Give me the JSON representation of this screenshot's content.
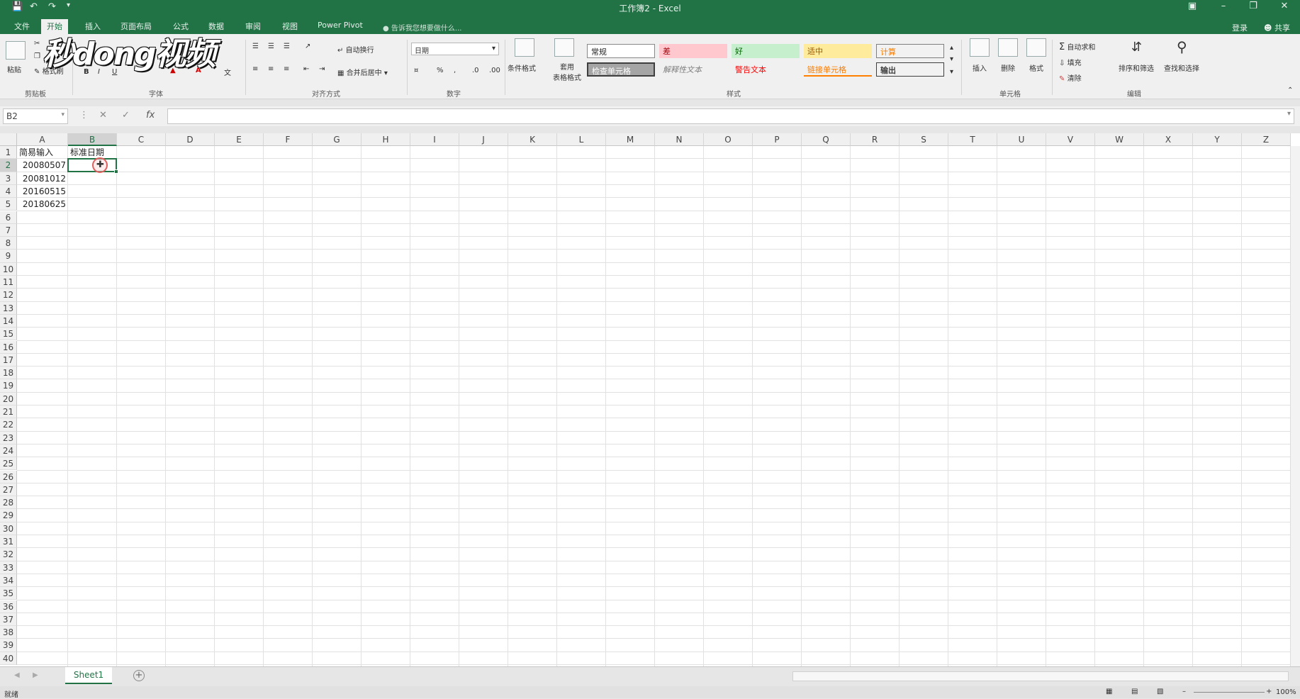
{
  "window": {
    "title": "工作簿2 - Excel",
    "quick_access": [
      "save-icon",
      "undo-icon",
      "redo-icon"
    ],
    "controls": [
      "ribbon-display-icon",
      "minimize-icon",
      "restore-icon",
      "close-icon"
    ]
  },
  "tabs": [
    "文件",
    "开始",
    "插入",
    "页面布局",
    "公式",
    "数据",
    "审阅",
    "视图",
    "Power Pivot"
  ],
  "active_tab": "开始",
  "tell_me": "告诉我您想要做什么...",
  "account": {
    "login": "登录",
    "share": "共享"
  },
  "watermark": "秒dong视频",
  "ribbon": {
    "clipboard": {
      "paste": "粘贴",
      "format_painter": "格式刷",
      "label": "剪贴板"
    },
    "font": {
      "label": "字体",
      "bold": "B",
      "italic": "I",
      "underline": "U"
    },
    "alignment": {
      "wrap": "自动换行",
      "merge": "合并后居中",
      "label": "对齐方式"
    },
    "number": {
      "format": "日期",
      "percent": "%",
      "label": "数字"
    },
    "styles": {
      "conditional": "条件格式",
      "table_format": "套用\n表格格式",
      "cells": [
        "常规",
        "差",
        "好",
        "适中",
        "计算",
        "检查单元格",
        "解释性文本",
        "警告文本",
        "链接单元格",
        "输出"
      ],
      "label": "样式"
    },
    "cells_group": {
      "insert": "插入",
      "delete": "删除",
      "format": "格式",
      "label": "单元格"
    },
    "editing": {
      "autosum": "自动求和",
      "fill": "填充",
      "clear": "清除",
      "sort": "排序和筛选",
      "find": "查找和选择",
      "label": "编辑"
    }
  },
  "formula_bar": {
    "name_box": "B2",
    "fx": "fx",
    "value": ""
  },
  "columns": [
    "A",
    "B",
    "C",
    "D",
    "E",
    "F",
    "G",
    "H",
    "I",
    "J",
    "K",
    "L",
    "M",
    "N",
    "O",
    "P",
    "Q",
    "R",
    "S",
    "T",
    "U",
    "V",
    "W",
    "X",
    "Y",
    "Z"
  ],
  "row_count": 40,
  "cells": {
    "A1": "简易输入",
    "B1": "标准日期",
    "A2": "20080507",
    "A3": "20081012",
    "A4": "20160515",
    "A5": "20180625"
  },
  "selected_cell": "B2",
  "sheets": [
    "Sheet1"
  ],
  "status": {
    "ready": "就绪",
    "zoom": "100%"
  }
}
